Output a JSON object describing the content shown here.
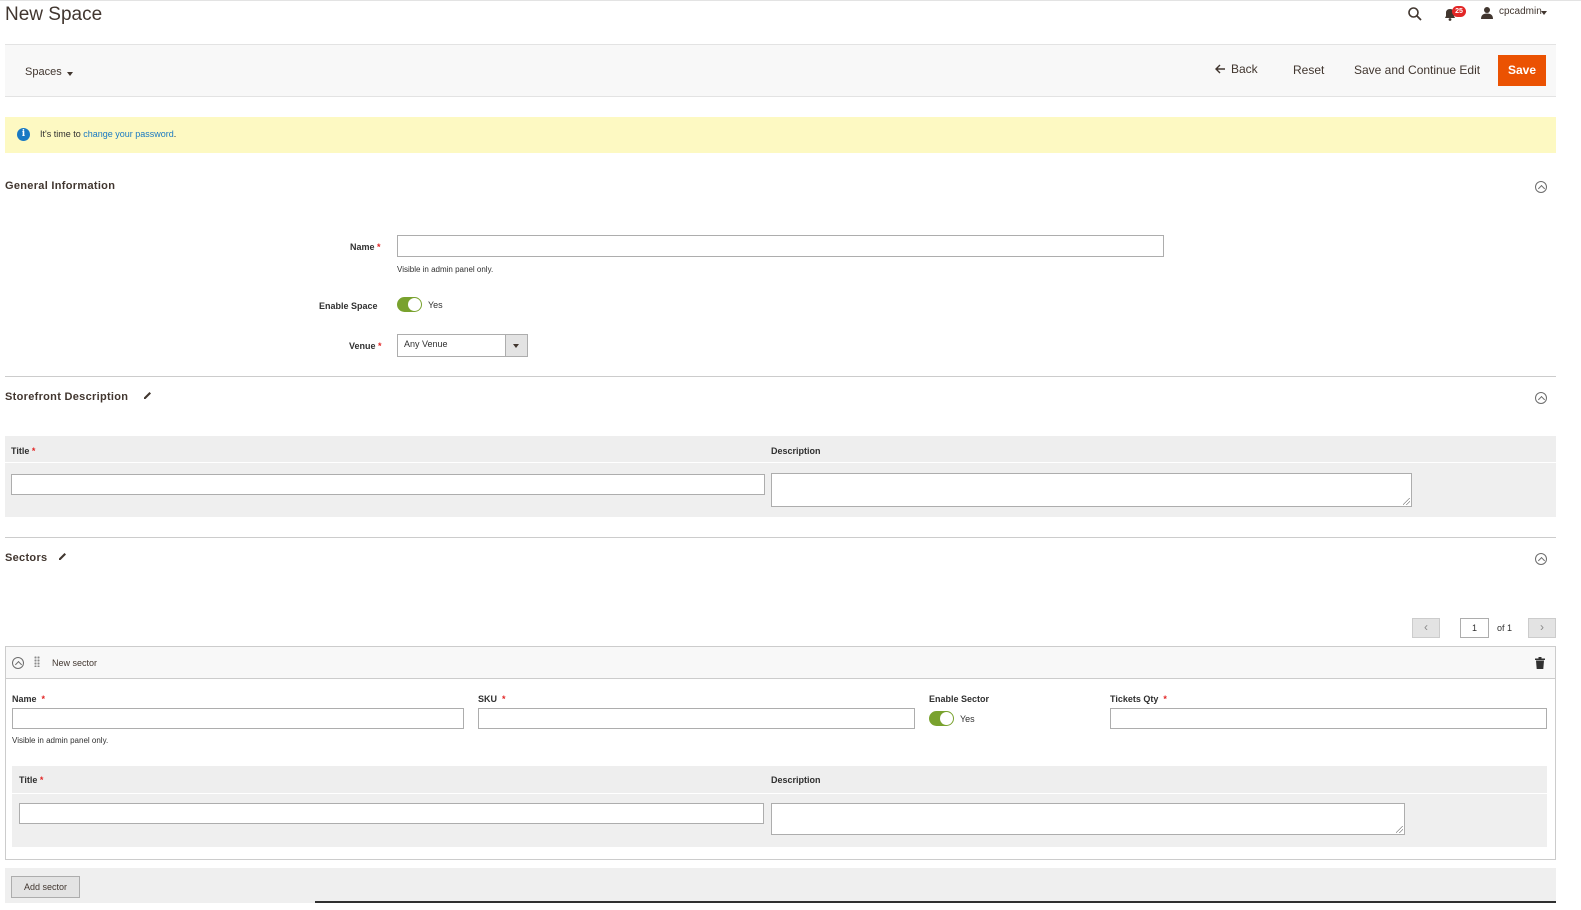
{
  "header": {
    "page_title": "New Space",
    "notification_count": "25",
    "user_name": "cpcadmin"
  },
  "actions": {
    "store_switcher": "Spaces",
    "back_label": "Back",
    "reset_label": "Reset",
    "save_continue_label": "Save and Continue Edit",
    "save_label": "Save"
  },
  "notice": {
    "prefix": "It's time to ",
    "link_text": "change your password",
    "suffix": "."
  },
  "general": {
    "title": "General Information",
    "name_label": "Name",
    "name_value": "",
    "name_note": "Visible in admin panel only.",
    "enable_label": "Enable Space",
    "enable_value": "Yes",
    "venue_label": "Venue",
    "venue_value": "Any Venue"
  },
  "storefront": {
    "title": "Storefront Description",
    "title_col": "Title",
    "description_col": "Description",
    "title_value": "",
    "description_value": ""
  },
  "sectors": {
    "title": "Sectors",
    "pager_page": "1",
    "pager_of": "of 1",
    "sector_name": "New sector",
    "name_label": "Name",
    "sku_label": "SKU",
    "enable_label": "Enable Sector",
    "enable_value": "Yes",
    "tickets_label": "Tickets Qty",
    "name_note": "Visible in admin panel only.",
    "title_col": "Title",
    "description_col": "Description",
    "add_label": "Add sector"
  },
  "colors": {
    "accent": "#eb5202",
    "toggle_on": "#79a22e",
    "notice_bg": "#fdf9c2",
    "link": "#1979c3",
    "required": "#e22626"
  },
  "icons": [
    "search-icon",
    "bell-icon",
    "user-icon",
    "arrow-left-icon",
    "info-icon",
    "collapse-icon",
    "pencil-icon",
    "drag-icon",
    "trash-icon",
    "chevron-left-icon",
    "chevron-right-icon"
  ]
}
